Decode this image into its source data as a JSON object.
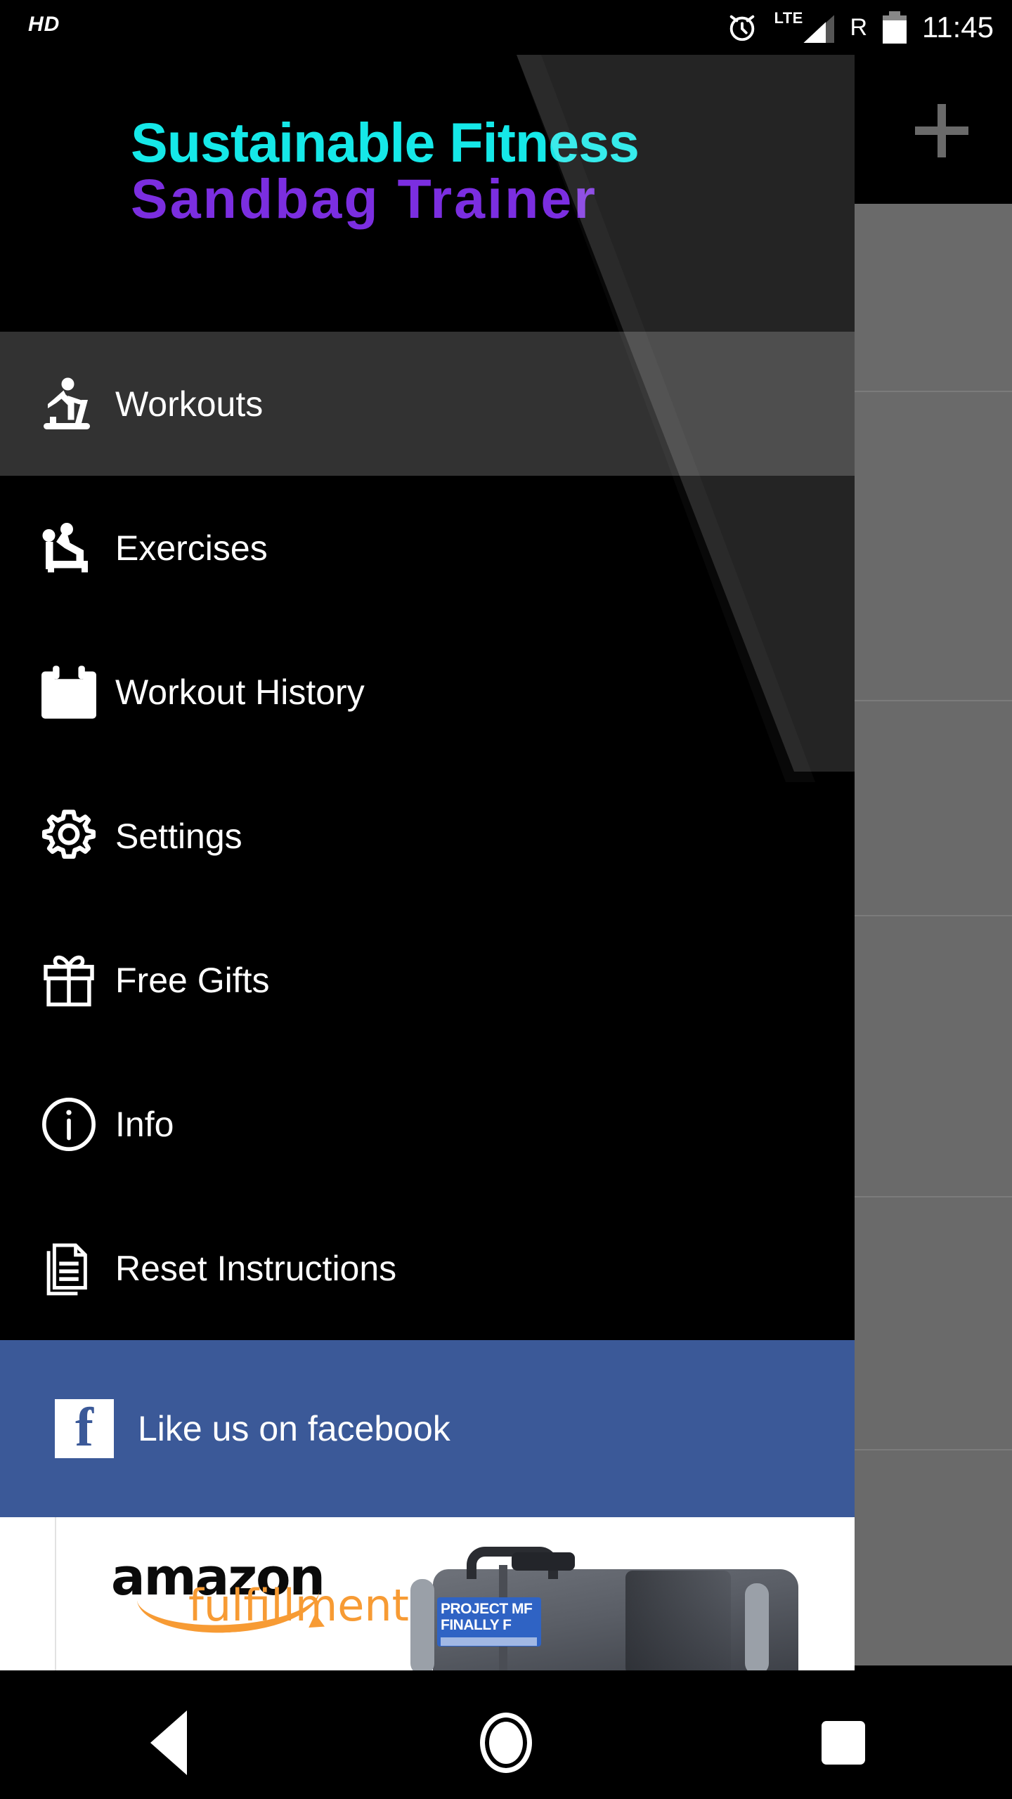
{
  "statusbar": {
    "hd_badge": "HD",
    "alarm_icon": "alarm-clock-icon",
    "network_label": "LTE",
    "roaming_label": "R",
    "battery_icon": "battery-icon",
    "time": "11:45"
  },
  "background_app": {
    "add_button_label": "+",
    "add_icon": "plus-icon"
  },
  "drawer": {
    "brand": {
      "line1": "Sustainable Fitness",
      "line2": "Sandbag Trainer",
      "line1_color": "#15e8e8",
      "line2_color": "#7b2ee0"
    },
    "items": [
      {
        "label": "Workouts",
        "icon": "treadmill-runner-icon",
        "active": true
      },
      {
        "label": "Exercises",
        "icon": "bench-press-icon",
        "active": false
      },
      {
        "label": "Workout History",
        "icon": "calendar-icon",
        "active": false
      },
      {
        "label": "Settings",
        "icon": "gear-icon",
        "active": false
      },
      {
        "label": "Free Gifts",
        "icon": "gift-icon",
        "active": false
      },
      {
        "label": "Info",
        "icon": "info-circle-icon",
        "active": false
      },
      {
        "label": "Reset Instructions",
        "icon": "documents-icon",
        "active": false
      }
    ],
    "facebook": {
      "label": "Like us on facebook",
      "icon": "facebook-logo-icon",
      "background_color": "#3b5998"
    },
    "ad": {
      "brand": "amazon",
      "tagline": "fulfillment",
      "brand_color": "#0a0a0a",
      "tagline_color": "#f79b34",
      "product_image": "sandbag-product-photo",
      "product_label_line1": "PROJECT MF",
      "product_label_line2": "FINALLY F"
    }
  },
  "navbar": {
    "back": "back-button",
    "home": "home-button",
    "recents": "recents-button"
  }
}
